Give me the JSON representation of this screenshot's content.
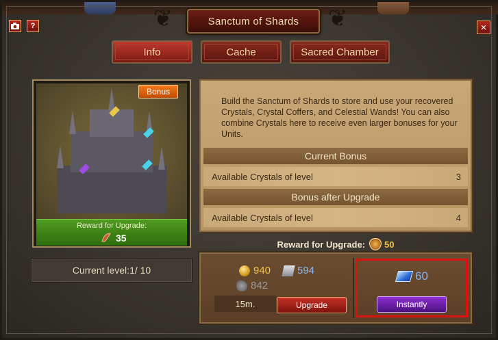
{
  "window": {
    "title": "Sanctum of Shards"
  },
  "header_buttons": {
    "camera_icon": "camera-icon",
    "help_label": "?",
    "close_label": "×"
  },
  "tabs": [
    {
      "label": "Info",
      "active": true
    },
    {
      "label": "Cache",
      "active": false
    },
    {
      "label": "Sacred Chamber",
      "active": false
    }
  ],
  "building": {
    "badge": "Bonus",
    "reward_label": "Reward for Upgrade:",
    "reward_value": "35",
    "current_level_label": "Current level:",
    "current_level_value": "1/ 10"
  },
  "info": {
    "description": "Build the Sanctum of Shards to store and use your recovered Crystals, Crystal Coffers, and Celestial Wands! You can also combine Crystals here to receive even larger bonuses for your Units.",
    "current_bonus_header": "Current Bonus",
    "current_bonus_row": {
      "label": "Available Crystals of level",
      "value": "3"
    },
    "after_upgrade_header": "Bonus after Upgrade",
    "after_upgrade_row": {
      "label": "Available Crystals of level",
      "value": "4"
    }
  },
  "reward_line": {
    "label": "Reward for Upgrade:",
    "value": "50"
  },
  "cost": {
    "gold": "940",
    "iron": "594",
    "stone": "842",
    "time": "15m.",
    "upgrade_label": "Upgrade"
  },
  "instant": {
    "gems": "60",
    "button_label": "Instantly"
  },
  "colors": {
    "gold_text": "#f3c44a",
    "iron_text": "#8fb6e8",
    "stone_text": "#9a9a9a",
    "gem_text": "#7fb4ff",
    "highlight": "#e01010"
  }
}
